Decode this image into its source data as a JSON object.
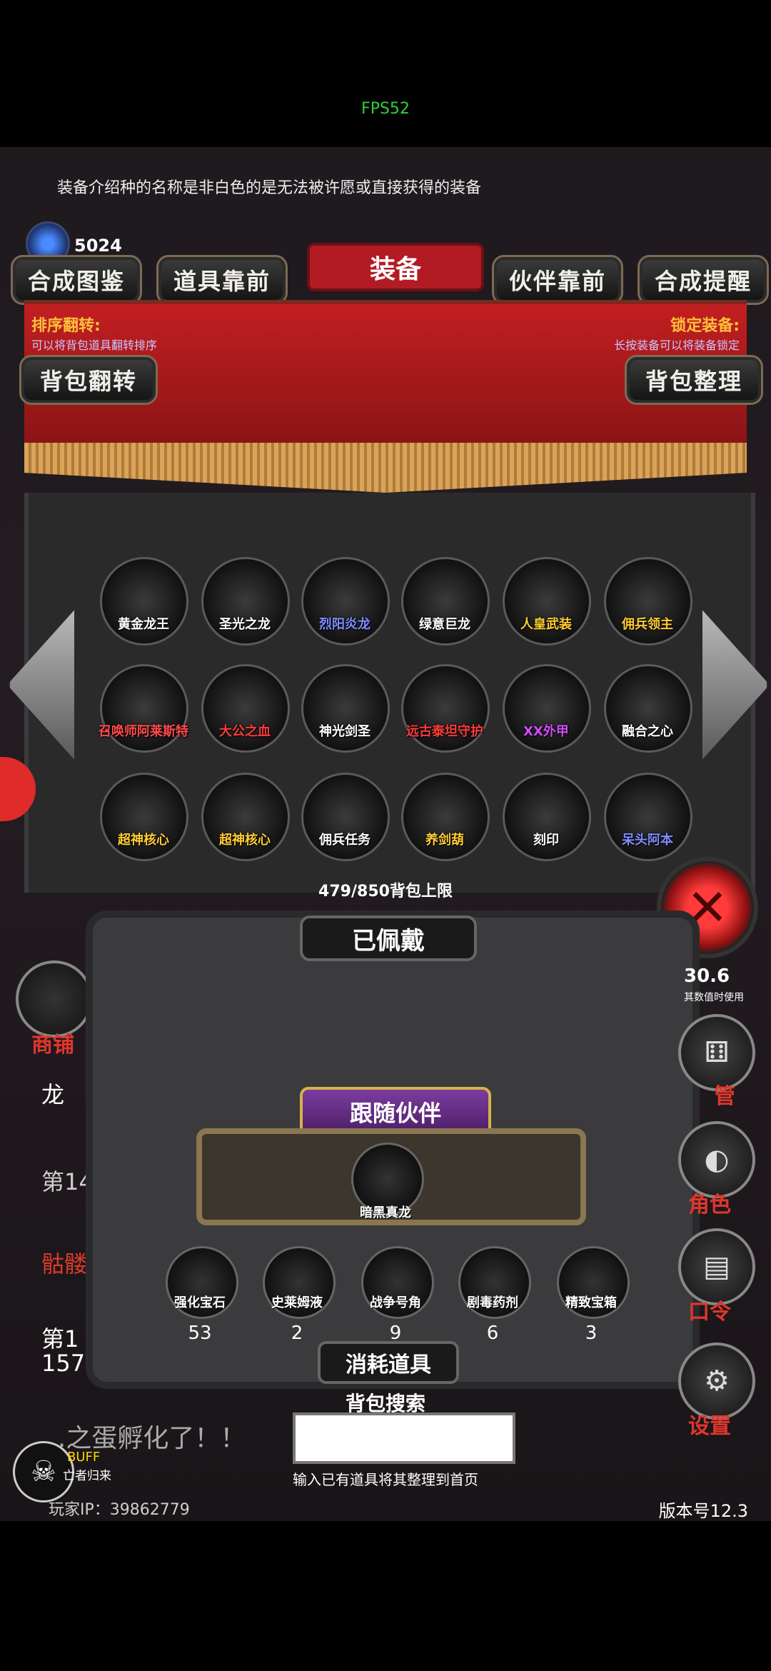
{
  "status": {
    "fps": "FPS52"
  },
  "tip": "装备介绍种的名称是非白色的是无法被许愿或直接获得的装备",
  "currency": {
    "count": "5024",
    "icon": "blue-gem-icon"
  },
  "top_buttons": [
    "合成图鉴",
    "道具靠前",
    "伙伴靠前",
    "合成提醒"
  ],
  "title": "装备",
  "sort": {
    "label": "排序翻转:",
    "desc": "可以将背包道具翻转排序",
    "button": "背包翻转"
  },
  "lock": {
    "label": "锁定装备:",
    "desc": "长按装备可以将装备锁定",
    "button": "背包整理"
  },
  "inventory": {
    "rows": [
      [
        "黄金龙王",
        "圣光之龙",
        "烈阳炎龙",
        "绿意巨龙",
        "人皇武装",
        "佣兵领主"
      ],
      [
        "召唤师阿莱斯特",
        "大公之血",
        "神光剑圣",
        "远古泰坦守护",
        "XX外甲",
        "融合之心"
      ],
      [
        "超神核心",
        "超神核心",
        "佣兵任务",
        "养剑葫",
        "刻印",
        "呆头阿本"
      ]
    ],
    "capacity": "479/850背包上限"
  },
  "equipped": {
    "title": "已佩戴"
  },
  "follow": {
    "button": "跟随伙伴",
    "companion": "暗黑真龙"
  },
  "consumables": {
    "items": [
      {
        "name": "强化宝石",
        "count": "53"
      },
      {
        "name": "史莱姆液",
        "count": "2"
      },
      {
        "name": "战争号角",
        "count": "9"
      },
      {
        "name": "剧毒药剂",
        "count": "6"
      },
      {
        "name": "精致宝箱",
        "count": "3"
      }
    ],
    "label": "消耗道具"
  },
  "search": {
    "title": "背包搜索",
    "hint": "输入已有道具将其整理到首页",
    "value": ""
  },
  "left_menu": {
    "shop": "商铺",
    "line1": "龙",
    "line2": "第14",
    "line3": "骷髅",
    "line4": "第1",
    "line5": "157",
    "message": "...之蛋孵化了！！",
    "buff": "BUFF",
    "buff_sub": "亡者归来"
  },
  "right_menu": {
    "partial_top": "30.6",
    "partial_sub": "其数值时使用",
    "manage": "管",
    "role": "角色",
    "code": "口令",
    "settings": "设置"
  },
  "footer": {
    "player": "玩家IP：39862779",
    "version": "版本号12.3"
  }
}
